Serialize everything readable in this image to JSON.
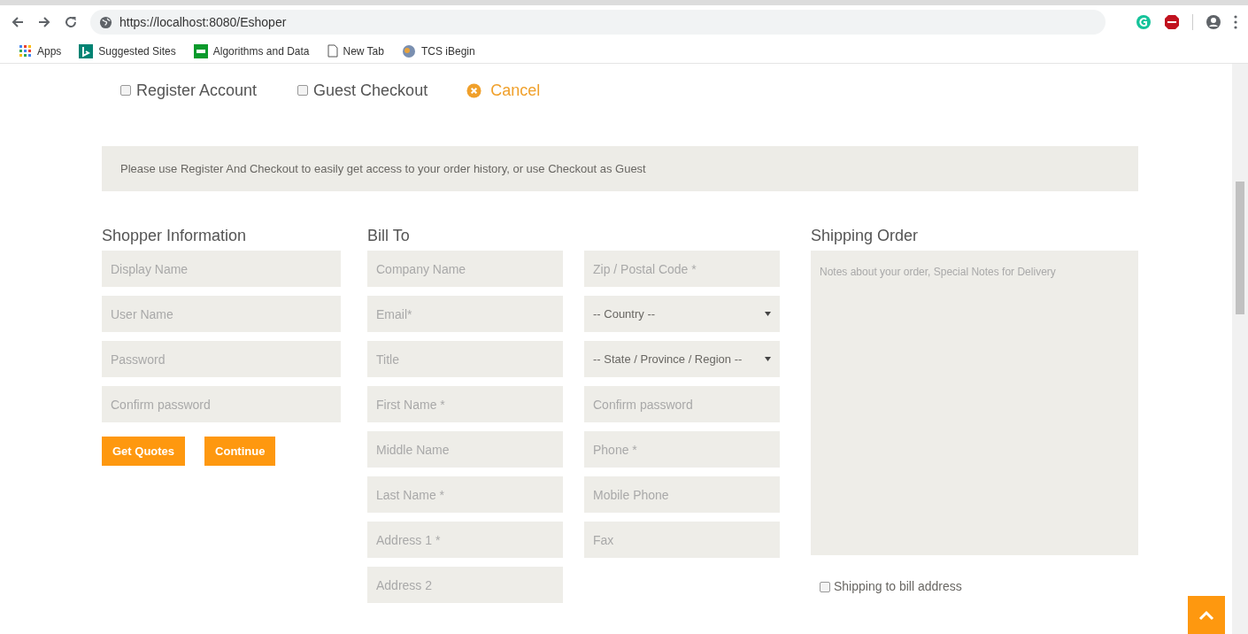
{
  "browser": {
    "url": "https://localhost:8080/Eshoper",
    "bookmarks": [
      {
        "label": "Apps",
        "kind": "apps"
      },
      {
        "label": "Suggested Sites",
        "kind": "bing"
      },
      {
        "label": "Algorithms and Data",
        "kind": "ftu"
      },
      {
        "label": "New Tab",
        "kind": "page"
      },
      {
        "label": "TCS iBegin",
        "kind": "globe"
      }
    ]
  },
  "options": [
    {
      "label": "Register Account",
      "checked": false
    },
    {
      "label": "Guest Checkout",
      "checked": false
    }
  ],
  "cancel": "Cancel",
  "notice": "Please use Register And Checkout to easily get access to your order history, or use Checkout as Guest",
  "shopper": {
    "title": "Shopper Information",
    "fields": [
      {
        "kind": "text",
        "placeholder": "Display Name"
      },
      {
        "kind": "text",
        "placeholder": "User Name"
      },
      {
        "kind": "text",
        "placeholder": "Password"
      },
      {
        "kind": "text",
        "placeholder": "Confirm password"
      }
    ],
    "buttons": [
      "Get Quotes",
      "Continue"
    ]
  },
  "bill_to": {
    "title": "Bill To",
    "columns": [
      [
        {
          "kind": "text",
          "placeholder": "Company Name"
        },
        {
          "kind": "text",
          "placeholder": "Email*"
        },
        {
          "kind": "text",
          "placeholder": "Title"
        },
        {
          "kind": "text",
          "placeholder": "First Name *"
        },
        {
          "kind": "text",
          "placeholder": "Middle Name"
        },
        {
          "kind": "text",
          "placeholder": "Last Name *"
        },
        {
          "kind": "text",
          "placeholder": "Address 1 *"
        },
        {
          "kind": "text",
          "placeholder": "Address 2"
        }
      ],
      [
        {
          "kind": "text",
          "placeholder": "Zip / Postal Code *"
        },
        {
          "kind": "select",
          "value": "-- Country --"
        },
        {
          "kind": "select",
          "value": "-- State / Province / Region --"
        },
        {
          "kind": "text",
          "placeholder": "Confirm password"
        },
        {
          "kind": "text",
          "placeholder": "Phone *"
        },
        {
          "kind": "text",
          "placeholder": "Mobile Phone"
        },
        {
          "kind": "text",
          "placeholder": "Fax"
        }
      ]
    ]
  },
  "shipping": {
    "title": "Shipping Order",
    "notes_placeholder": "Notes about your order, Special Notes for Delivery",
    "ship_to_bill": {
      "label": "Shipping to bill address",
      "checked": false
    }
  }
}
